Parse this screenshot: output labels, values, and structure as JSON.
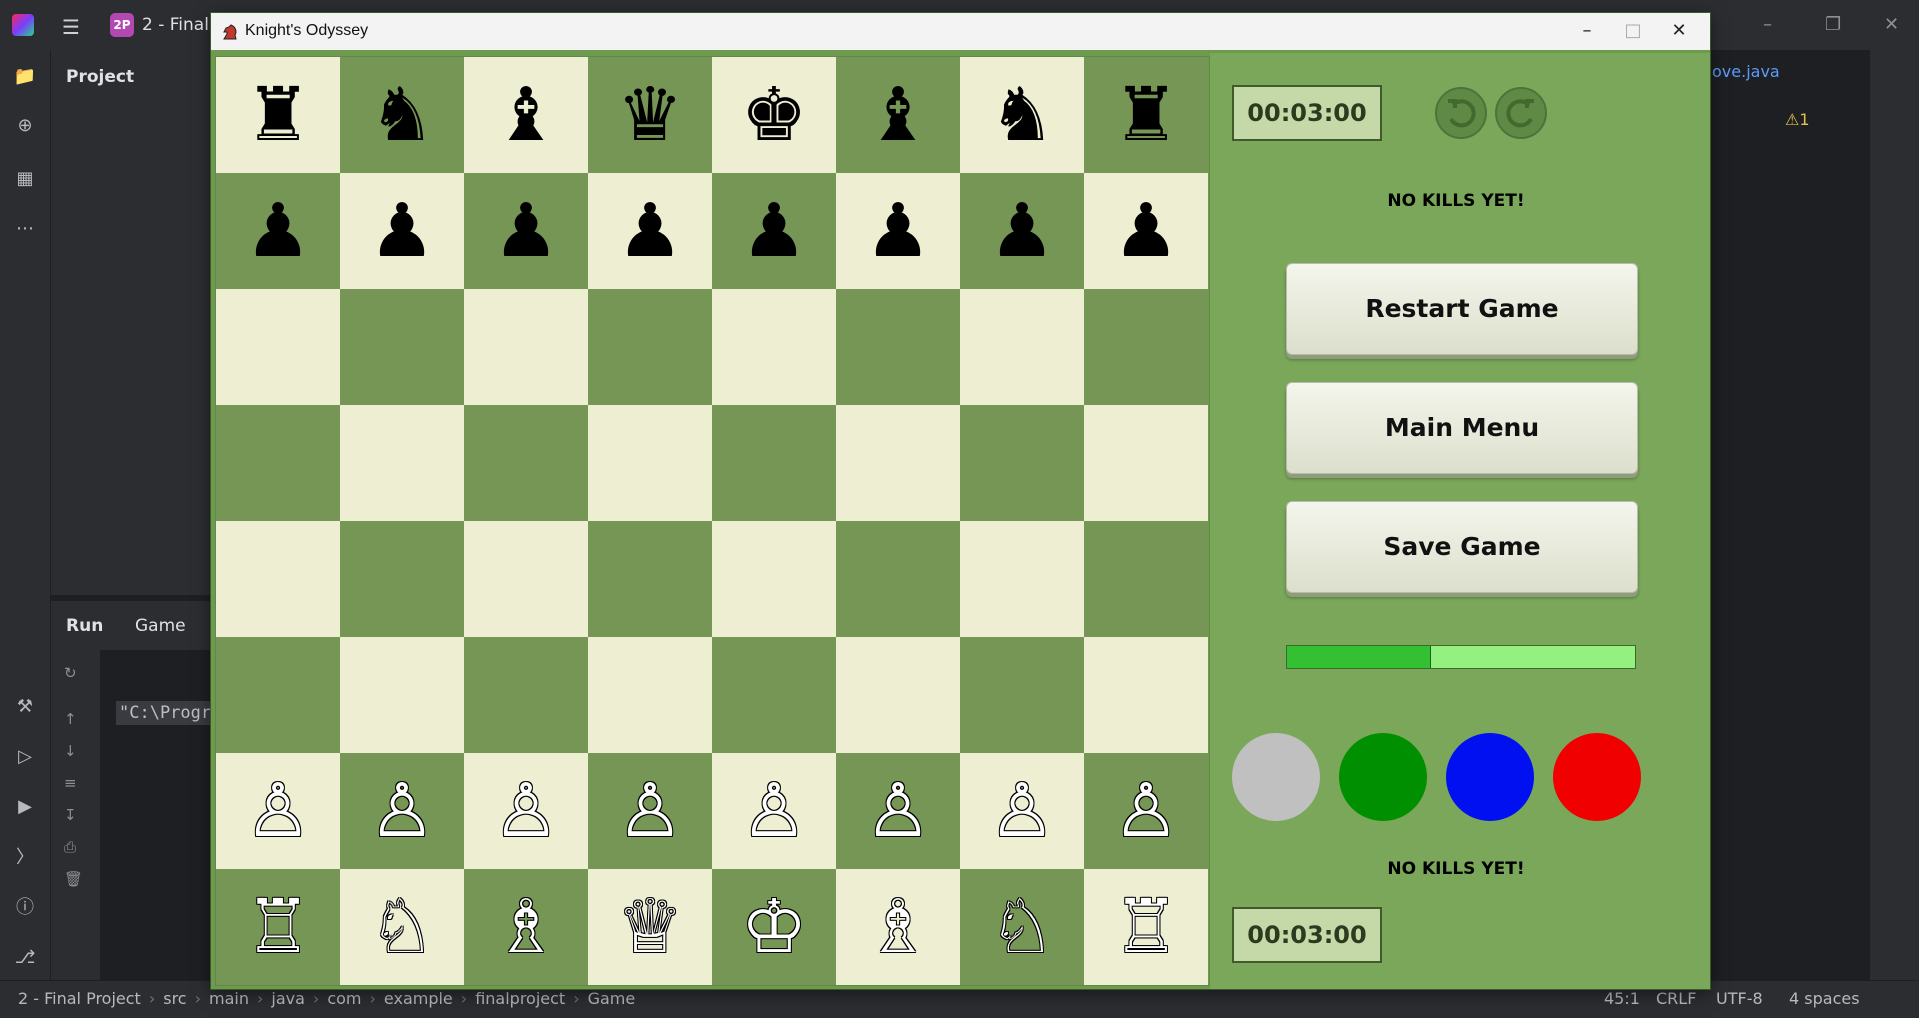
{
  "ide": {
    "project_badge": "2P",
    "project_title": "2 - Final",
    "project_panel_title": "Project",
    "run_tab": "Run",
    "game_tab": "Game",
    "console_text": "\"C:\\Progr",
    "editor_tab": "ove.java",
    "warning": "⚠1",
    "status": {
      "breadcrumbs": [
        "2 - Final Project",
        "src",
        "main",
        "java",
        "com",
        "example",
        "finalproject",
        "Game"
      ],
      "position": "45:1",
      "line_sep": "CRLF",
      "encoding": "UTF-8",
      "indent": "4 spaces"
    }
  },
  "window": {
    "title": "Knight's Odyssey",
    "controls": {
      "minimize": "–",
      "maximize": "□",
      "close": "✕"
    }
  },
  "board": {
    "colors": {
      "light": "#eeeed2",
      "dark": "#769656"
    },
    "rows": [
      [
        "♜",
        "♞",
        "♝",
        "♛",
        "♚",
        "♝",
        "♞",
        "♜"
      ],
      [
        "♟",
        "♟",
        "♟",
        "♟",
        "♟",
        "♟",
        "♟",
        "♟"
      ],
      [
        "",
        "",
        "",
        "",
        "",
        "",
        "",
        ""
      ],
      [
        "",
        "",
        "",
        "",
        "",
        "",
        "",
        ""
      ],
      [
        "",
        "",
        "",
        "",
        "",
        "",
        "",
        ""
      ],
      [
        "",
        "",
        "",
        "",
        "",
        "",
        "",
        ""
      ],
      [
        "♙",
        "♙",
        "♙",
        "♙",
        "♙",
        "♙",
        "♙",
        "♙"
      ],
      [
        "♖",
        "♘",
        "♗",
        "♕",
        "♔",
        "♗",
        "♘",
        "♖"
      ]
    ],
    "piece_colors": [
      [
        "b",
        "b",
        "b",
        "b",
        "b",
        "b",
        "b",
        "b"
      ],
      [
        "b",
        "b",
        "b",
        "b",
        "b",
        "b",
        "b",
        "b"
      ],
      [
        "",
        "",
        "",
        "",
        "",
        "",
        "",
        ""
      ],
      [
        "",
        "",
        "",
        "",
        "",
        "",
        "",
        ""
      ],
      [
        "",
        "",
        "",
        "",
        "",
        "",
        "",
        ""
      ],
      [
        "",
        "",
        "",
        "",
        "",
        "",
        "",
        ""
      ],
      [
        "w",
        "w",
        "w",
        "w",
        "w",
        "w",
        "w",
        "w"
      ],
      [
        "w",
        "w",
        "w",
        "w",
        "w",
        "w",
        "w",
        "w"
      ]
    ]
  },
  "sidebar": {
    "top_timer": "00:03:00",
    "bottom_timer": "00:03:00",
    "top_kills": "NO KILLS YET!",
    "bottom_kills": "NO KILLS YET!",
    "buttons": {
      "restart": "Restart Game",
      "main_menu": "Main Menu",
      "save": "Save Game"
    },
    "progress_fraction": 0.41,
    "swatches": [
      "#c0c0c0",
      "#008f00",
      "#0010f0",
      "#f00000"
    ]
  }
}
